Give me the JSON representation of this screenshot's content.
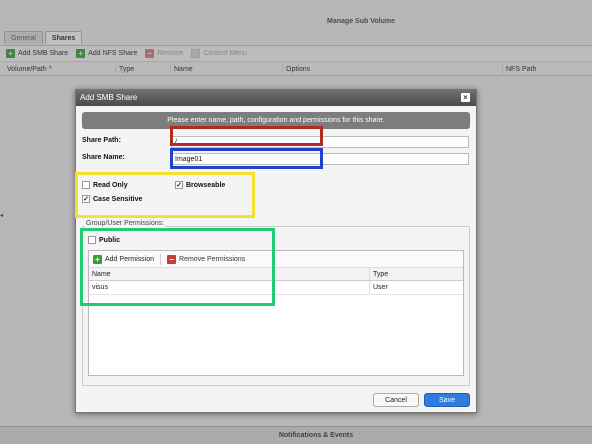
{
  "window": {
    "title": "Manage Sub Volume",
    "footer": "Notifications & Events"
  },
  "tabs": [
    {
      "label": "General",
      "active": false
    },
    {
      "label": "Shares",
      "active": true
    }
  ],
  "toolbar": {
    "add_smb": "Add SMB Share",
    "add_nfs": "Add NFS Share",
    "remove": "Remove",
    "context_menu": "Context Menu"
  },
  "columns": {
    "volume_path": "Volume/Path",
    "sort_indicator": "^",
    "type": "Type",
    "name": "Name",
    "options": "Options",
    "nfs_path": "NFS Path"
  },
  "dialog": {
    "title": "Add SMB Share",
    "close_glyph": "×",
    "instruction": "Please enter name, path, configuration and permissions for this share.",
    "share_path_label": "Share Path:",
    "share_path_value": "/",
    "share_name_label": "Share Name:",
    "share_name_value": "Image01",
    "read_only_label": "Read Only",
    "read_only_checked": false,
    "browseable_label": "Browseable",
    "browseable_checked": true,
    "case_sensitive_label": "Case Sensitive",
    "case_sensitive_checked": true,
    "group_legend": "Group/User Permissions:",
    "public_label": "Public",
    "public_checked": false,
    "add_permission": "Add Permission",
    "remove_permissions": "Remove Permissions",
    "table_headers": {
      "name": "Name",
      "type": "Type"
    },
    "rows": [
      {
        "name": "visus",
        "type": "User"
      }
    ],
    "cancel": "Cancel",
    "save": "Save"
  },
  "annotation_colors": {
    "red": "#b22b1f",
    "blue": "#2142c9",
    "yellow": "#f2e22c",
    "green": "#22cc77"
  }
}
